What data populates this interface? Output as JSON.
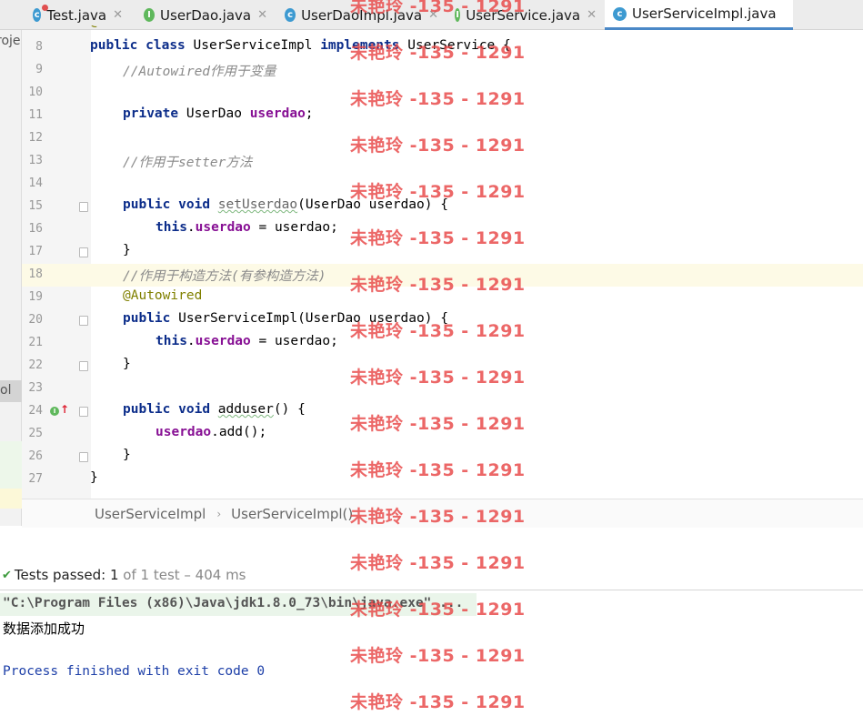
{
  "tabs": [
    {
      "label": "Test.java",
      "icon": "class-icon",
      "kind": "class"
    },
    {
      "label": "UserDao.java",
      "icon": "interface-icon",
      "kind": "iface"
    },
    {
      "label": "UserDaoImpl.java",
      "icon": "class-icon",
      "kind": "class"
    },
    {
      "label": "UserService.java",
      "icon": "interface-icon",
      "kind": "iface"
    },
    {
      "label": "UserServiceImpl.java",
      "icon": "class-icon",
      "kind": "class"
    }
  ],
  "left_panel": {
    "label_top": "roje",
    "label_mid": "ol"
  },
  "code": {
    "line_numbers": [
      "8",
      "9",
      "10",
      "11",
      "12",
      "13",
      "14",
      "15",
      "16",
      "17",
      "18",
      "19",
      "20",
      "21",
      "22",
      "23",
      "24",
      "25",
      "26",
      "27"
    ],
    "l8": {
      "kw1": "public",
      "kw2": "class",
      "name": "UserServiceImpl",
      "kw3": "implements",
      "iface": "UserService",
      "brace": "{"
    },
    "l9": "//Autowired作用于变量",
    "l11": {
      "kw": "private",
      "type": "UserDao",
      "field": "userdao",
      "end": ";"
    },
    "l13": "//作用于setter方法",
    "l15": {
      "kw1": "public",
      "kw2": "void",
      "method": "setUserdao",
      "params": "(UserDao userdao) {"
    },
    "l16": {
      "kw": "this",
      "dot": ".",
      "field": "userdao",
      "rest": " = userdao;"
    },
    "l17": "}",
    "l18": "//作用于构造方法(有参构造方法)",
    "l19": "@Autowired",
    "l20": {
      "kw": "public",
      "rest": "UserServiceImpl(UserDao userdao) {"
    },
    "l21": {
      "kw": "this",
      "dot": ".",
      "field": "userdao",
      "rest": " = userdao;"
    },
    "l22": "}",
    "l24": {
      "kw1": "public",
      "kw2": "void",
      "method": "adduser",
      "rest": "() {"
    },
    "l25": {
      "field": "userdao",
      "rest": ".add();"
    },
    "l26": "}",
    "l27": "}"
  },
  "breadcrumb": {
    "class": "UserServiceImpl",
    "method": "UserServiceImpl()"
  },
  "run": {
    "status_label": "Tests passed:",
    "passed": "1",
    "of_total": "of 1 test – 404 ms",
    "cmd": "\"C:\\Program Files (x86)\\Java\\jdk1.8.0_73\\bin\\java.exe\" ...",
    "output": "数据添加成功",
    "exit": "Process finished with exit code 0"
  },
  "watermark": "未艳玲 -135 - 1291"
}
